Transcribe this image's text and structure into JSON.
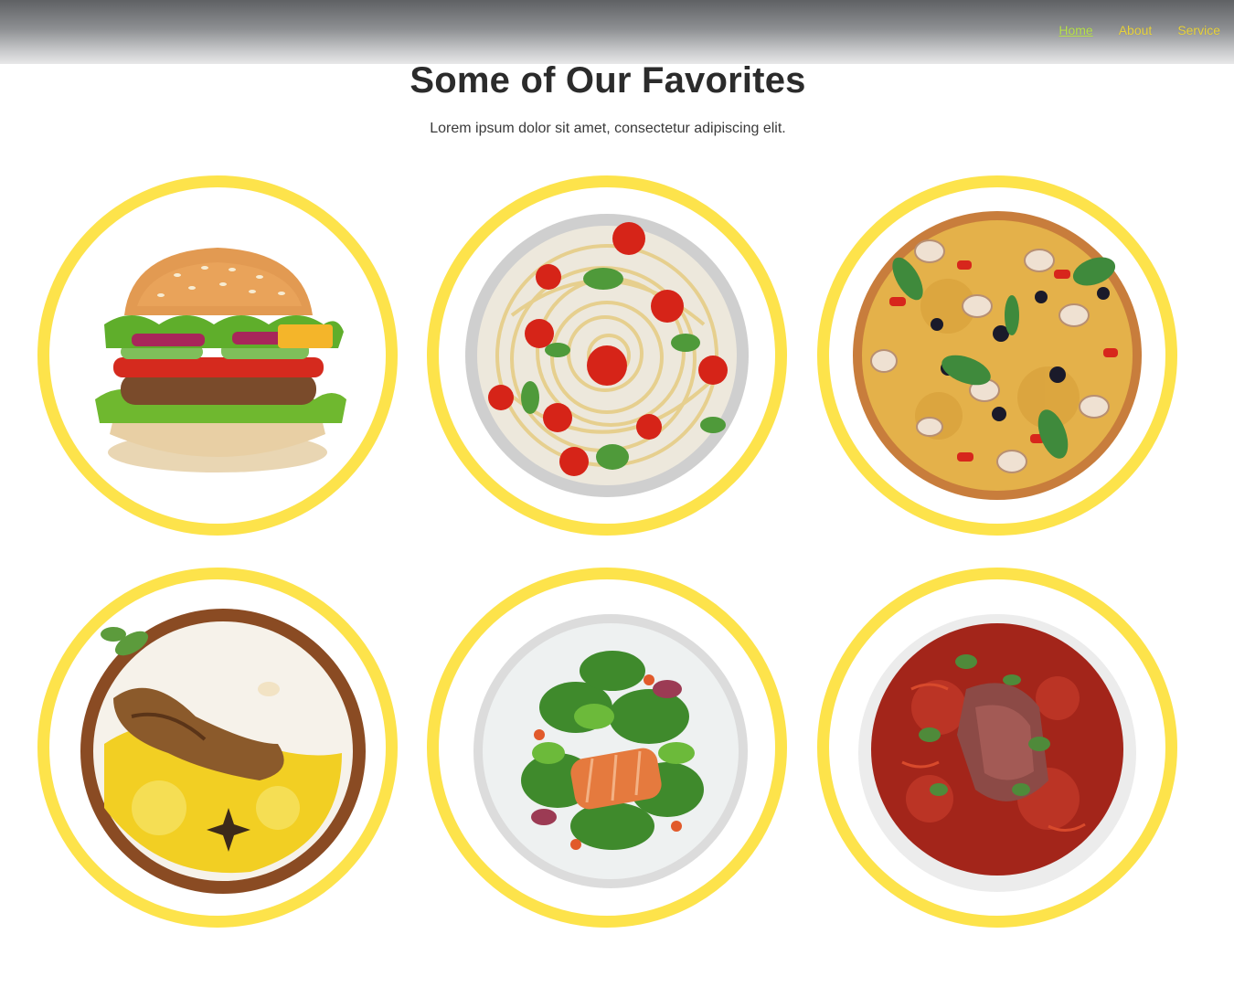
{
  "nav": {
    "items": [
      {
        "label": "Home",
        "active": true
      },
      {
        "label": "About",
        "active": false
      },
      {
        "label": "Service",
        "active": false
      }
    ]
  },
  "section": {
    "title": "Some of Our Favorites",
    "subtitle": "Lorem ipsum dolor sit amet, consectetur adipiscing elit."
  },
  "colors": {
    "ring": "#fde34b",
    "nav_link": "#e8d23c",
    "nav_active": "#b7e14a",
    "title": "#2b2b2b"
  },
  "dishes": [
    {
      "icon": "burger-image"
    },
    {
      "icon": "spaghetti-image"
    },
    {
      "icon": "pizza-image"
    },
    {
      "icon": "biryani-image"
    },
    {
      "icon": "salmon-salad-image"
    },
    {
      "icon": "borscht-soup-image"
    }
  ]
}
